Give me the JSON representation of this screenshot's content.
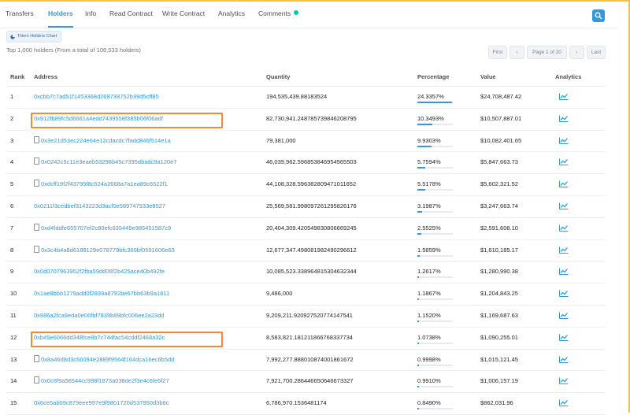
{
  "tabs": [
    {
      "label": "Transfers",
      "active": false
    },
    {
      "label": "Holders",
      "active": true
    },
    {
      "label": "Info",
      "active": false
    },
    {
      "label": "Read Contract",
      "active": false
    },
    {
      "label": "Write Contract",
      "active": false
    },
    {
      "label": "Analytics",
      "active": false
    },
    {
      "label": "Comments",
      "active": false
    }
  ],
  "icons": {
    "search": "search-icon",
    "doc": "contract-doc-icon",
    "analytics": "analytics-chart-icon",
    "pie": "pie-chart-icon"
  },
  "colors": {
    "accent": "#3498db",
    "highlight": "#f08b3c",
    "comment_dot": "#00c9a7"
  },
  "chart_button": {
    "label": "Token Holders Chart"
  },
  "summary": "Top 1,000 holders (From a total of 108,533 holders)",
  "pager": {
    "first": "First",
    "prev": "‹",
    "page": "Page 1 of 20",
    "next": "›",
    "last": "Last"
  },
  "table": {
    "headers": {
      "rank": "Rank",
      "address": "Address",
      "quantity": "Quantity",
      "percentage": "Percentage",
      "value": "Value",
      "analytics": "Analytics"
    },
    "rows": [
      {
        "rank": "1",
        "address": "0xcbb7c7ad51f1453368d268738752b39d5cff85",
        "contract": false,
        "quantity": "194,535,439.88183524",
        "percentage": "24.3357%",
        "pct": 24.3357,
        "value": "$24,708,487.42",
        "highlighted": false
      },
      {
        "rank": "2",
        "address": "0x912fb89fc5d6661a4edd7439558f385b06f06adf",
        "contract": false,
        "quantity": "82,730,941.248785739846208795",
        "percentage": "10.3493%",
        "pct": 10.3493,
        "value": "$10,507,887.01",
        "highlighted": true
      },
      {
        "rank": "3",
        "address": "0x3e21d53ec224e64e12cdacdc7fadd846f514e1a",
        "contract": true,
        "quantity": "79,381,000",
        "percentage": "9.9303%",
        "pct": 9.9303,
        "value": "$10,082,401.65",
        "highlighted": false
      },
      {
        "rank": "4",
        "address": "0x0242c5c11e3eaeb53298b45c7395dbadc8a120e7",
        "contract": true,
        "quantity": "46,039,962.596853846954565503",
        "percentage": "5.7594%",
        "pct": 5.7594,
        "value": "$5,847,663.73",
        "highlighted": false
      },
      {
        "rank": "5",
        "address": "0xdcff19f2f43795f8c524a2668a7a1ea89c6522f1",
        "contract": true,
        "quantity": "44,108,328.596382809471011652",
        "percentage": "5.5178%",
        "pct": 5.5178,
        "value": "$5,602,321.52",
        "highlighted": false
      },
      {
        "rank": "6",
        "address": "0x0211f3cedbef3143223d3acf0e589747933e8527",
        "contract": false,
        "quantity": "25,569,581.998097261295826176",
        "percentage": "3.1987%",
        "pct": 3.1987,
        "value": "$3,247,663.74",
        "highlighted": false
      },
      {
        "rank": "7",
        "address": "0xd4fddfe655707ef2c80efc635445e985451587c9",
        "contract": true,
        "quantity": "20,404,309.420549830806669245",
        "percentage": "2.5525%",
        "pct": 2.5525,
        "value": "$2,591,608.10",
        "highlighted": false
      },
      {
        "rank": "8",
        "address": "0x3c4b4a8d6188129e078779bfc365bf0591606e63",
        "contract": true,
        "quantity": "12,677,347.498081982490296612",
        "percentage": "1.5859%",
        "pct": 1.5859,
        "value": "$1,610,185.17",
        "highlighted": false
      },
      {
        "rank": "9",
        "address": "0x0d0707963952f2fba59dd06f2b425ace40b492fe",
        "contract": false,
        "quantity": "10,085,523.338964815304632344",
        "percentage": "1.2617%",
        "pct": 1.2617,
        "value": "$1,280,990.38",
        "highlighted": false
      },
      {
        "rank": "10",
        "address": "0x1ae8bbb1279add0f2839a8792be67bb63b9a1811",
        "contract": false,
        "quantity": "9,486,000",
        "percentage": "1.1867%",
        "pct": 1.1867,
        "value": "$1,204,843.25",
        "highlighted": false
      },
      {
        "rank": "11",
        "address": "0x986a2fca9eda0e06fbf7839b89bfc006ee2a23dd",
        "contract": false,
        "quantity": "9,209,211.920927520774147541",
        "percentage": "1.1520%",
        "pct": 1.152,
        "value": "$1,169,687.63",
        "highlighted": false
      },
      {
        "rank": "12",
        "address": "0xb45e6066dd348fce8b7c744fac54cddf2468a32c",
        "contract": false,
        "quantity": "8,583,821.181211866768337734",
        "percentage": "1.0738%",
        "pct": 1.0738,
        "value": "$1,090,255.01",
        "highlighted": true
      },
      {
        "rank": "13",
        "address": "0x8a46d8d3c66094e2889f9564f164dca16ec6b5dd",
        "contract": true,
        "quantity": "7,992,277.888010874001861672",
        "percentage": "0.9998%",
        "pct": 0.9998,
        "value": "$1,015,121.45",
        "highlighted": false
      },
      {
        "rank": "14",
        "address": "0x0c8f9a56544cc988f1873a038de2f3e4c6fe6f27",
        "contract": true,
        "quantity": "7,921,700.286446650646673327",
        "percentage": "0.9910%",
        "pct": 0.991,
        "value": "$1,006,157.19",
        "highlighted": false
      },
      {
        "rank": "15",
        "address": "0x6ce5ab09c879eee997e9f9801720d537950d3b6c",
        "contract": false,
        "quantity": "6,786,970.1536481174",
        "percentage": "0.8490%",
        "pct": 0.849,
        "value": "$862,031.96",
        "highlighted": false
      }
    ]
  }
}
